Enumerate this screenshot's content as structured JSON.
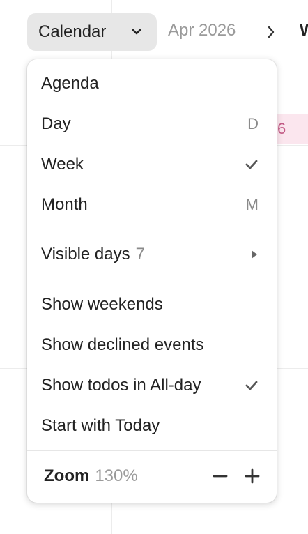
{
  "header": {
    "view_select_label": "Calendar",
    "month_label": "Apr 2026",
    "clipped_text": "W"
  },
  "menu": {
    "view_items": [
      {
        "label": "Agenda",
        "shortcut": ""
      },
      {
        "label": "Day",
        "shortcut": "D"
      },
      {
        "label": "Week",
        "shortcut": "",
        "checked": true
      },
      {
        "label": "Month",
        "shortcut": "M"
      }
    ],
    "visible_days": {
      "label": "Visible days",
      "value": "7"
    },
    "toggles": [
      {
        "label": "Show weekends",
        "checked": false
      },
      {
        "label": "Show declined events",
        "checked": false
      },
      {
        "label": "Show todos in All-day",
        "checked": true
      },
      {
        "label": "Start with Today",
        "checked": false
      }
    ],
    "zoom": {
      "label": "Zoom",
      "value": "130%"
    }
  },
  "background": {
    "event_glyph": "6"
  },
  "colors": {
    "menu_bg": "#ffffff",
    "select_bg": "#e7e7e7",
    "muted_text": "#8a8a8a",
    "event_bg": "#fbe6ee"
  }
}
